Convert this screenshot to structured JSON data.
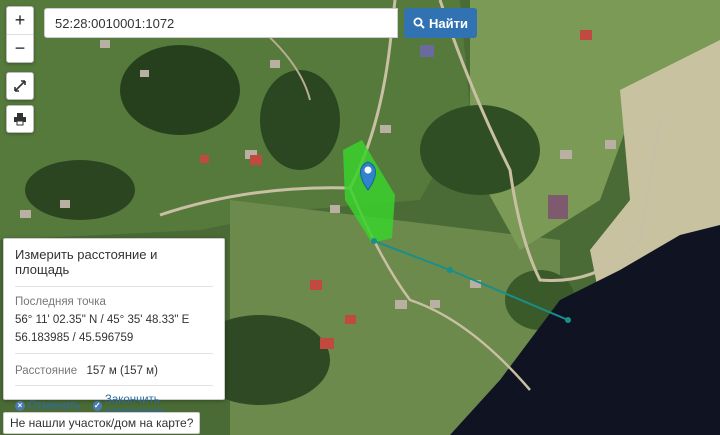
{
  "search": {
    "value": "52:28:0010001:1072",
    "button_label": "Найти"
  },
  "zoom": {
    "in_label": "+",
    "out_label": "−"
  },
  "measure_panel": {
    "title": "Измерить расстояние и площадь",
    "last_point_label": "Последняя точка",
    "dms": "56° 11' 02.35\" N / 45° 35' 48.33\" E",
    "decimal": "56.183985 / 45.596759",
    "distance_label": "Расстояние",
    "distance_value": "157 м (157 м)",
    "cancel_label": "Отменить",
    "finish_label": "Закончить измерение"
  },
  "not_found_label": "Не нашли участок/дом на карте?",
  "colors": {
    "accent": "#3072b2",
    "parcel_fill": "#39d12b",
    "measure_line": "#1a8f8a",
    "water": "#0f1322",
    "marker": "#2f84cc"
  },
  "icons": {
    "search": "search-icon",
    "fullscreen": "fullscreen-icon",
    "print": "print-icon",
    "cancel": "close-circle-icon",
    "finish": "check-circle-icon",
    "marker": "location-pin-icon"
  }
}
